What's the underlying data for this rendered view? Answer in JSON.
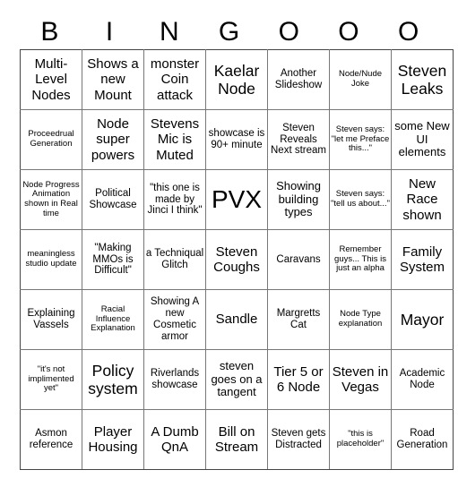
{
  "header": [
    "B",
    "I",
    "N",
    "G",
    "O",
    "O",
    "O"
  ],
  "rows": [
    [
      "Multi-Level Nodes",
      "Shows a new Mount",
      "monster Coin attack",
      "Kaelar Node",
      "Another Slideshow",
      "Node/Nude Joke",
      "Steven Leaks"
    ],
    [
      "Proceedrual Generation",
      "Node super powers",
      "Stevens Mic is Muted",
      "showcase is 90+ minute",
      "Steven Reveals Next stream",
      "Steven says: \"let me Preface this...\"",
      "some New UI elements"
    ],
    [
      "Node Progress Animation shown in Real time",
      "Political Showcase",
      "\"this one is made by Jinci I think\"",
      "PVX",
      "Showing building types",
      "Steven says: \"tell us about...\"",
      "New Race shown"
    ],
    [
      "meaningless studio update",
      "\"Making MMOs is Difficult\"",
      "a Techniqual Glitch",
      "Steven Coughs",
      "Caravans",
      "Remember guys... This is just an alpha",
      "Family System"
    ],
    [
      "Explaining Vassels",
      "Racial Influence Explanation",
      "Showing A new Cosmetic armor",
      "Sandle",
      "Margretts Cat",
      "Node Type explanation",
      "Mayor"
    ],
    [
      "\"it's not implimented yet\"",
      "Policy system",
      "Riverlands showcase",
      "steven goes on a tangent",
      "Tier 5 or 6 Node",
      "Steven in Vegas",
      "Academic Node"
    ],
    [
      "Asmon reference",
      "Player Housing",
      "A Dumb QnA",
      "Bill on Stream",
      "Steven gets Distracted",
      "\"this is placeholder\"",
      "Road Generation"
    ]
  ]
}
